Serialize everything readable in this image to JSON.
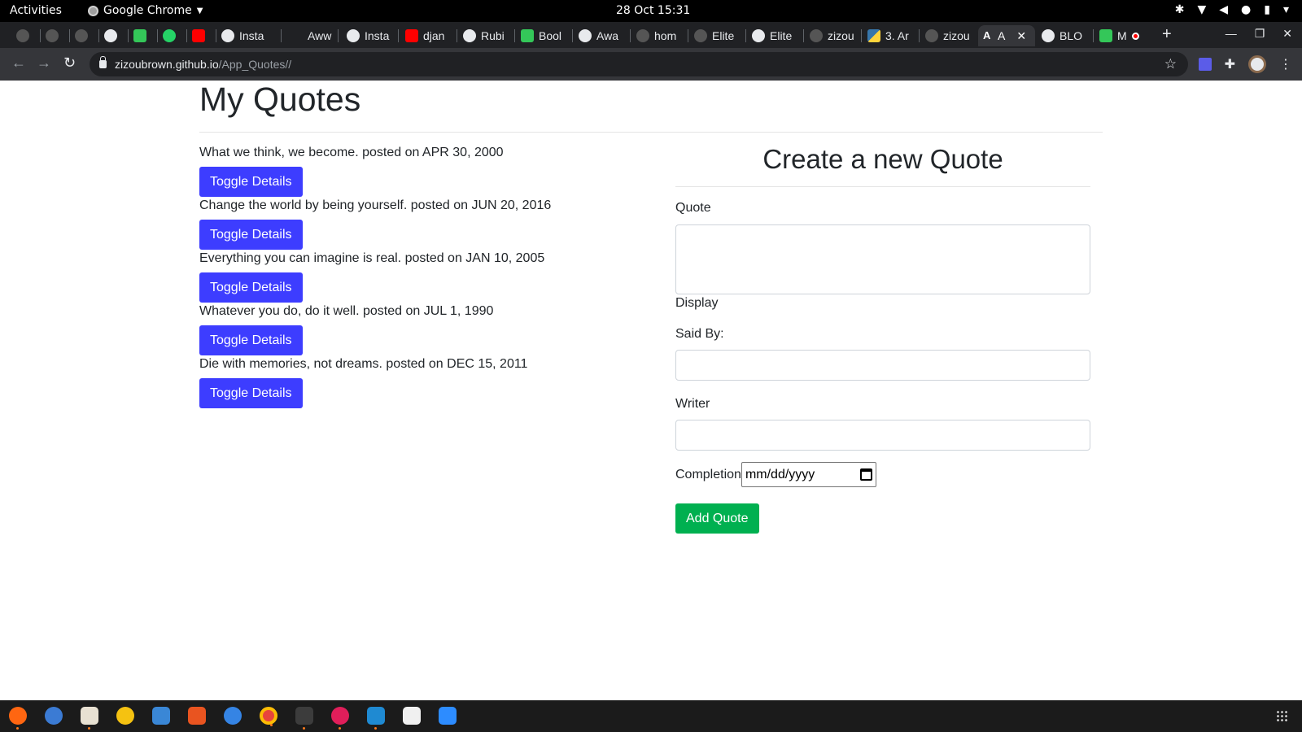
{
  "system_bar": {
    "activities": "Activities",
    "app_name": "Google Chrome",
    "clock": "28 Oct  15:31"
  },
  "tabs": [
    {
      "label": "",
      "icon": "plant-icon"
    },
    {
      "label": "",
      "icon": "plant-icon"
    },
    {
      "label": "",
      "icon": "github-icon"
    },
    {
      "label": "",
      "icon": "globe-icon"
    },
    {
      "label": "",
      "icon": "pycharm-icon"
    },
    {
      "label": "",
      "icon": "whatsapp-icon"
    },
    {
      "label": "",
      "icon": "youtube-icon"
    },
    {
      "label": "Insta",
      "icon": "globe-icon"
    },
    {
      "label": "Aww",
      "icon": "blank-icon"
    },
    {
      "label": "Insta",
      "icon": "globe-icon"
    },
    {
      "label": "djan",
      "icon": "youtube-icon"
    },
    {
      "label": "Rubi",
      "icon": "globe-icon"
    },
    {
      "label": "Bool",
      "icon": "sheet-icon"
    },
    {
      "label": "Awa",
      "icon": "globe-icon"
    },
    {
      "label": "hom",
      "icon": "github-icon"
    },
    {
      "label": "Elite",
      "icon": "github-icon"
    },
    {
      "label": "Elite",
      "icon": "globe-icon"
    },
    {
      "label": "zizou",
      "icon": "github-icon"
    },
    {
      "label": "3. Ar",
      "icon": "python-icon"
    },
    {
      "label": "zizou",
      "icon": "github-icon"
    },
    {
      "label": "A",
      "icon": "angular-icon",
      "active": true
    },
    {
      "label": "BLO",
      "icon": "globe-icon"
    },
    {
      "label": "M",
      "icon": "meet-icon"
    }
  ],
  "address_bar": {
    "host": "zizoubrown.github.io",
    "path": "/App_Quotes//"
  },
  "page": {
    "title": "My Quotes",
    "quotes": [
      {
        "text": "What we think, we become. posted on APR 30, 2000",
        "button": "Toggle Details"
      },
      {
        "text": "Change the world by being yourself. posted on JUN 20, 2016",
        "button": "Toggle Details"
      },
      {
        "text": "Everything you can imagine is real. posted on JAN 10, 2005",
        "button": "Toggle Details"
      },
      {
        "text": "Whatever you do, do it well. posted on JUL 1, 1990",
        "button": "Toggle Details"
      },
      {
        "text": "Die with memories, not dreams. posted on DEC 15, 2011",
        "button": "Toggle Details"
      }
    ],
    "form": {
      "title": "Create a new Quote",
      "quote_label": "Quote",
      "quote_value": "",
      "display_label": "Display",
      "said_by_label": "Said By:",
      "said_by_value": "",
      "writer_label": "Writer",
      "writer_value": "",
      "completion_label": "Completion",
      "completion_placeholder": "mm/dd/yyyy",
      "submit_label": "Add Quote"
    }
  },
  "colors": {
    "toggle_button": "#3d3dff",
    "add_button": "#00b050",
    "chrome_dark": "#202124"
  },
  "dock_apps": [
    "firefox-icon",
    "thunderbird-icon",
    "files-icon",
    "rhythmbox-icon",
    "writer-icon",
    "software-icon",
    "help-icon",
    "chrome-icon",
    "terminal-icon",
    "slack-icon",
    "vscode-icon",
    "text-editor-icon",
    "zoom-icon"
  ]
}
